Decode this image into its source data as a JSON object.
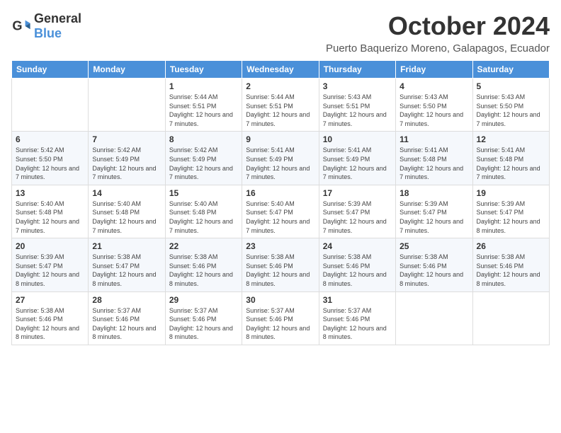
{
  "logo": {
    "general": "General",
    "blue": "Blue"
  },
  "title": {
    "month": "October 2024",
    "location": "Puerto Baquerizo Moreno, Galapagos, Ecuador"
  },
  "weekdays": [
    "Sunday",
    "Monday",
    "Tuesday",
    "Wednesday",
    "Thursday",
    "Friday",
    "Saturday"
  ],
  "weeks": [
    [
      {
        "day": "",
        "info": ""
      },
      {
        "day": "",
        "info": ""
      },
      {
        "day": "1",
        "info": "Sunrise: 5:44 AM\nSunset: 5:51 PM\nDaylight: 12 hours and 7 minutes."
      },
      {
        "day": "2",
        "info": "Sunrise: 5:44 AM\nSunset: 5:51 PM\nDaylight: 12 hours and 7 minutes."
      },
      {
        "day": "3",
        "info": "Sunrise: 5:43 AM\nSunset: 5:51 PM\nDaylight: 12 hours and 7 minutes."
      },
      {
        "day": "4",
        "info": "Sunrise: 5:43 AM\nSunset: 5:50 PM\nDaylight: 12 hours and 7 minutes."
      },
      {
        "day": "5",
        "info": "Sunrise: 5:43 AM\nSunset: 5:50 PM\nDaylight: 12 hours and 7 minutes."
      }
    ],
    [
      {
        "day": "6",
        "info": "Sunrise: 5:42 AM\nSunset: 5:50 PM\nDaylight: 12 hours and 7 minutes."
      },
      {
        "day": "7",
        "info": "Sunrise: 5:42 AM\nSunset: 5:49 PM\nDaylight: 12 hours and 7 minutes."
      },
      {
        "day": "8",
        "info": "Sunrise: 5:42 AM\nSunset: 5:49 PM\nDaylight: 12 hours and 7 minutes."
      },
      {
        "day": "9",
        "info": "Sunrise: 5:41 AM\nSunset: 5:49 PM\nDaylight: 12 hours and 7 minutes."
      },
      {
        "day": "10",
        "info": "Sunrise: 5:41 AM\nSunset: 5:49 PM\nDaylight: 12 hours and 7 minutes."
      },
      {
        "day": "11",
        "info": "Sunrise: 5:41 AM\nSunset: 5:48 PM\nDaylight: 12 hours and 7 minutes."
      },
      {
        "day": "12",
        "info": "Sunrise: 5:41 AM\nSunset: 5:48 PM\nDaylight: 12 hours and 7 minutes."
      }
    ],
    [
      {
        "day": "13",
        "info": "Sunrise: 5:40 AM\nSunset: 5:48 PM\nDaylight: 12 hours and 7 minutes."
      },
      {
        "day": "14",
        "info": "Sunrise: 5:40 AM\nSunset: 5:48 PM\nDaylight: 12 hours and 7 minutes."
      },
      {
        "day": "15",
        "info": "Sunrise: 5:40 AM\nSunset: 5:48 PM\nDaylight: 12 hours and 7 minutes."
      },
      {
        "day": "16",
        "info": "Sunrise: 5:40 AM\nSunset: 5:47 PM\nDaylight: 12 hours and 7 minutes."
      },
      {
        "day": "17",
        "info": "Sunrise: 5:39 AM\nSunset: 5:47 PM\nDaylight: 12 hours and 7 minutes."
      },
      {
        "day": "18",
        "info": "Sunrise: 5:39 AM\nSunset: 5:47 PM\nDaylight: 12 hours and 7 minutes."
      },
      {
        "day": "19",
        "info": "Sunrise: 5:39 AM\nSunset: 5:47 PM\nDaylight: 12 hours and 8 minutes."
      }
    ],
    [
      {
        "day": "20",
        "info": "Sunrise: 5:39 AM\nSunset: 5:47 PM\nDaylight: 12 hours and 8 minutes."
      },
      {
        "day": "21",
        "info": "Sunrise: 5:38 AM\nSunset: 5:47 PM\nDaylight: 12 hours and 8 minutes."
      },
      {
        "day": "22",
        "info": "Sunrise: 5:38 AM\nSunset: 5:46 PM\nDaylight: 12 hours and 8 minutes."
      },
      {
        "day": "23",
        "info": "Sunrise: 5:38 AM\nSunset: 5:46 PM\nDaylight: 12 hours and 8 minutes."
      },
      {
        "day": "24",
        "info": "Sunrise: 5:38 AM\nSunset: 5:46 PM\nDaylight: 12 hours and 8 minutes."
      },
      {
        "day": "25",
        "info": "Sunrise: 5:38 AM\nSunset: 5:46 PM\nDaylight: 12 hours and 8 minutes."
      },
      {
        "day": "26",
        "info": "Sunrise: 5:38 AM\nSunset: 5:46 PM\nDaylight: 12 hours and 8 minutes."
      }
    ],
    [
      {
        "day": "27",
        "info": "Sunrise: 5:38 AM\nSunset: 5:46 PM\nDaylight: 12 hours and 8 minutes."
      },
      {
        "day": "28",
        "info": "Sunrise: 5:37 AM\nSunset: 5:46 PM\nDaylight: 12 hours and 8 minutes."
      },
      {
        "day": "29",
        "info": "Sunrise: 5:37 AM\nSunset: 5:46 PM\nDaylight: 12 hours and 8 minutes."
      },
      {
        "day": "30",
        "info": "Sunrise: 5:37 AM\nSunset: 5:46 PM\nDaylight: 12 hours and 8 minutes."
      },
      {
        "day": "31",
        "info": "Sunrise: 5:37 AM\nSunset: 5:46 PM\nDaylight: 12 hours and 8 minutes."
      },
      {
        "day": "",
        "info": ""
      },
      {
        "day": "",
        "info": ""
      }
    ]
  ]
}
